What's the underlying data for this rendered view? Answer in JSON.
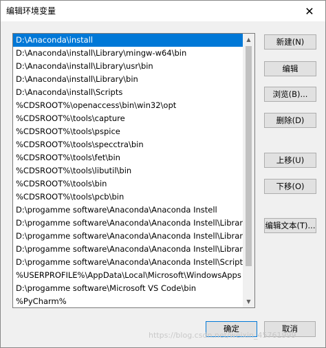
{
  "window": {
    "title": "编辑环境变量",
    "close_glyph": "✕"
  },
  "list": {
    "items": [
      "D:\\Anaconda\\install",
      "D:\\Anaconda\\install\\Library\\mingw-w64\\bin",
      "D:\\Anaconda\\install\\Library\\usr\\bin",
      "D:\\Anaconda\\install\\Library\\bin",
      "D:\\Anaconda\\install\\Scripts",
      "%CDSROOT%\\openaccess\\bin\\win32\\opt",
      "%CDSROOT%\\tools\\capture",
      "%CDSROOT%\\tools\\pspice",
      "%CDSROOT%\\tools\\specctra\\bin",
      "%CDSROOT%\\tools\\fet\\bin",
      "%CDSROOT%\\tools\\libutil\\bin",
      "%CDSROOT%\\tools\\bin",
      "%CDSROOT%\\tools\\pcb\\bin",
      "D:\\progamme software\\Anaconda\\Anaconda Instell",
      "D:\\progamme software\\Anaconda\\Anaconda Instell\\Library\\...",
      "D:\\progamme software\\Anaconda\\Anaconda Instell\\Library\\...",
      "D:\\progamme software\\Anaconda\\Anaconda Instell\\Library\\...",
      "D:\\progamme software\\Anaconda\\Anaconda Instell\\Scripts",
      "%USERPROFILE%\\AppData\\Local\\Microsoft\\WindowsApps",
      "D:\\progamme software\\Microsoft VS Code\\bin",
      "%PyCharm%"
    ],
    "selected_index": 0
  },
  "buttons": {
    "new": "新建(N)",
    "edit": "编辑",
    "browse": "浏览(B)...",
    "delete": "删除(D)",
    "move_up": "上移(U)",
    "move_down": "下移(O)",
    "edit_text": "编辑文本(T)...",
    "ok": "确定",
    "cancel": "取消"
  },
  "watermark": "https://blog.csdn.net/weixin_45761999",
  "colors": {
    "selection": "#0078d7",
    "dialog_bg": "#f0f0f0",
    "button_bg": "#e1e1e1"
  }
}
